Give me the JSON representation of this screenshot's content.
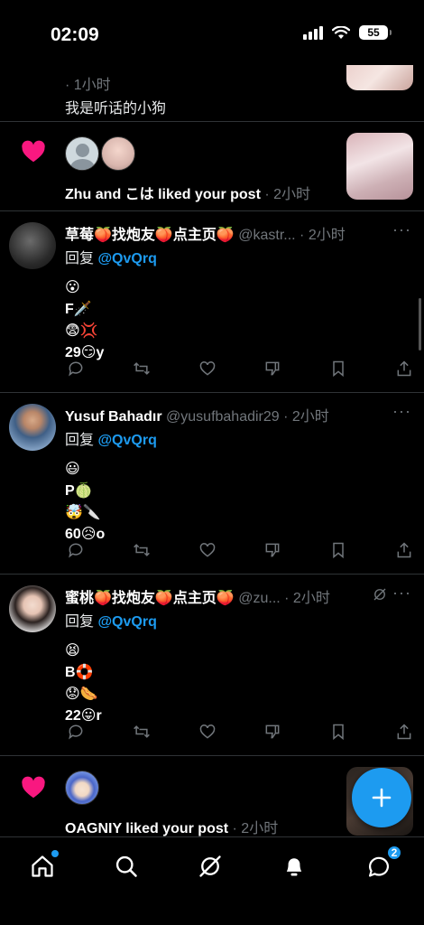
{
  "status_bar": {
    "time": "02:09",
    "battery": "55"
  },
  "feed": {
    "item_top": {
      "meta": "· 1小时",
      "text": "我是听话的小狗"
    },
    "like_notif_1": {
      "text": "Zhu and こは liked your post",
      "meta": " · 2小时"
    },
    "post_1": {
      "name": "草莓🍑找炮友🍑点主页🍑",
      "handle_time": " @kastr... · 2小时",
      "reply_prefix": "回复 ",
      "mention": "@QvQrq",
      "lines": [
        "😮",
        "F🗡️",
        "😨💢",
        "29😏y"
      ]
    },
    "post_2": {
      "name": "Yusuf Bahadır",
      "handle_time": " @yusufbahadir29 · 2小时",
      "reply_prefix": "回复 ",
      "mention": "@QvQrq",
      "lines": [
        "😃",
        "P🍈",
        "🤯🔪",
        "60😥o"
      ]
    },
    "post_3": {
      "name": "蜜桃🍑找炮友🍑点主页🍑",
      "handle_time": " @zu... · 2小时",
      "reply_prefix": "回复 ",
      "mention": "@QvQrq",
      "lines": [
        "😫",
        "B🛟",
        "😟🌭",
        "22😛r"
      ]
    },
    "like_notif_2": {
      "text": "OAGNIY liked your post",
      "meta": " · 2小时"
    }
  },
  "tabs": {
    "messages_badge": "2"
  },
  "colors": {
    "accent": "#1d9bf0",
    "like": "#f91880",
    "muted": "#71767b"
  },
  "icons": [
    "heart-icon",
    "reply-icon",
    "repost-icon",
    "like-icon",
    "downvote-icon",
    "bookmark-icon",
    "share-icon",
    "home-icon",
    "search-icon",
    "grok-icon",
    "bell-icon",
    "messages-icon",
    "plus-icon"
  ]
}
